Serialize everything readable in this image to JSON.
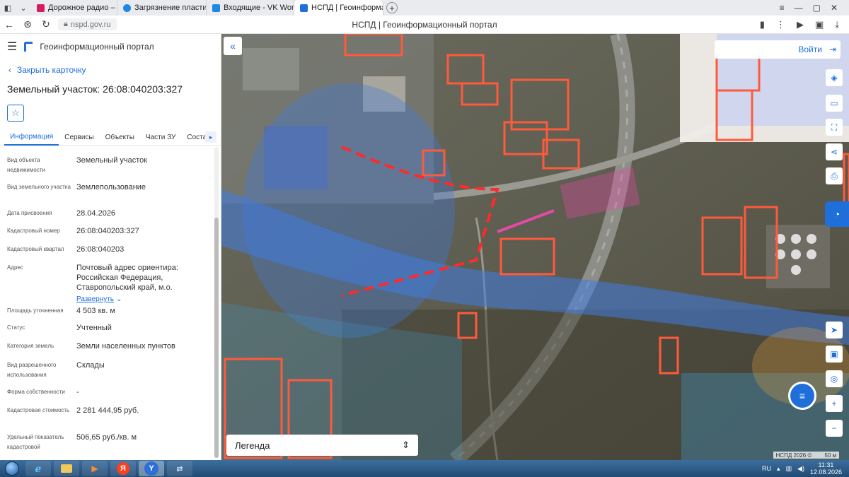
{
  "browser": {
    "tabs": [
      {
        "label": "Дорожное радио –",
        "color": "#d81b60",
        "active": false
      },
      {
        "label": "Загрязнение пластиком",
        "color": "#1e88e5",
        "active": false
      },
      {
        "label": "Входящие - VK WorkMail",
        "color": "#1e88e5",
        "active": false
      },
      {
        "label": "НСПД | Геоинформацио",
        "color": "#1e6fd9",
        "active": true
      }
    ],
    "url": "nspd.gov.ru",
    "page_title": "НСПД | Геоинформационный портал"
  },
  "app": {
    "name": "Геоинформационный портал",
    "close_card": "Закрыть карточку",
    "card_title": "Земельный участок: 26:08:040203:327",
    "tabs": [
      "Информация",
      "Сервисы",
      "Объекты",
      "Части ЗУ",
      "Состав"
    ],
    "rows": [
      {
        "label": "Вид объекта недвижимости",
        "value": "Земельный участок"
      },
      {
        "label": "Вид земельного участка",
        "value": "Землепользование"
      },
      {
        "label": "Дата присвоения",
        "value": "28.04.2026"
      },
      {
        "label": "Кадастровый номер",
        "value": "26:08:040203:327"
      },
      {
        "label": "Кадастровый квартал",
        "value": "26:08:040203"
      },
      {
        "label": "Адрес",
        "value": "Почтовый адрес ориентира: Российская Федерация, Ставропольский край, м.о."
      },
      {
        "label": "Площадь уточненная",
        "value": "4 503 кв. м"
      },
      {
        "label": "Статус",
        "value": "Учтенный"
      },
      {
        "label": "Категория земель",
        "value": "Земли населенных пунктов"
      },
      {
        "label": "Вид разрешенного использования",
        "value": "Склады"
      },
      {
        "label": "Форма собственности",
        "value": "-"
      },
      {
        "label": "Кадастровая стоимость",
        "value": "2 281 444,95 руб."
      },
      {
        "label": "Удельный показатель кадастровой",
        "value": "506,65 руб./кв. м"
      }
    ],
    "expand_label": "Развернуть"
  },
  "map": {
    "login_label": "Войти",
    "legend_label": "Легенда",
    "attribution": "НСПД 2026 ©",
    "scale_label": "50 м"
  },
  "taskbar": {
    "lang": "RU",
    "time": "11:31",
    "date": "12.08.2026"
  },
  "colors": {
    "accent": "#1e6fd9",
    "parcel": "#ff5a3c",
    "zone": "#3f7be0",
    "highlight": "#e64aa8"
  }
}
